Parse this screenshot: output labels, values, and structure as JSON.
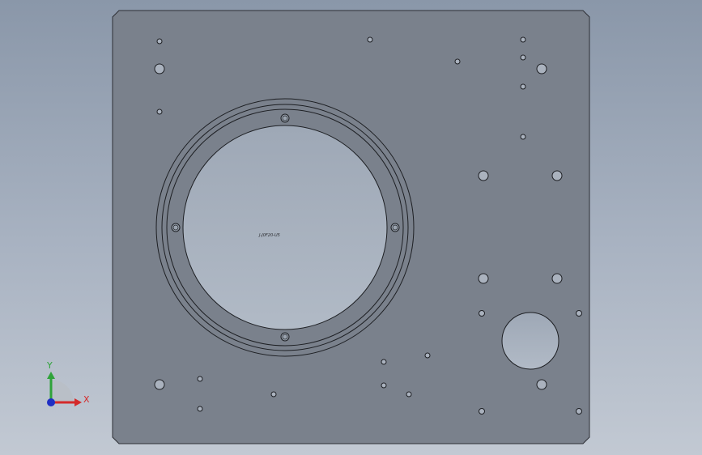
{
  "viewport": {
    "background_top": "#8a97a9",
    "background_bottom": "#c2c9d3"
  },
  "part": {
    "plate_color": "#7a818c",
    "edge_color": "#2e3036",
    "center_text": "J-J0F20-U5"
  },
  "triad": {
    "x_label": "X",
    "y_label": "Y",
    "x_color": "#d42a2a",
    "y_color": "#2fa33a",
    "z_color": "#1f2fc4"
  }
}
